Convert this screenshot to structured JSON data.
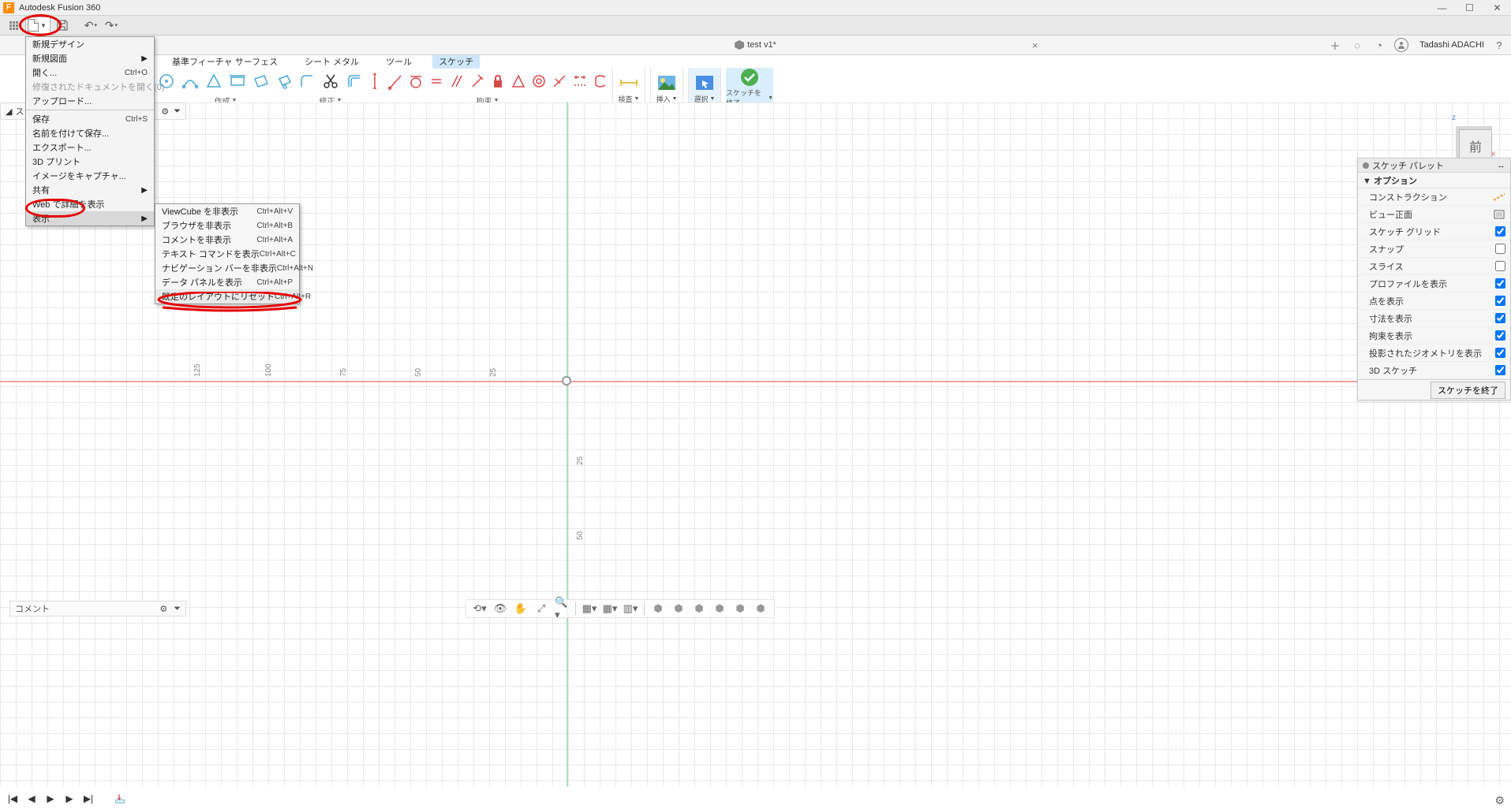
{
  "titlebar": {
    "app": "F",
    "title": "Autodesk Fusion 360"
  },
  "doc": {
    "name": "test v1*",
    "username": "Tadashi ADACHI"
  },
  "tabs": [
    "基準フィーチャ サーフェス",
    "シート メタル",
    "ツール",
    "スケッチ"
  ],
  "active_tab": "スケッチ",
  "ribbon": {
    "create": "作成",
    "modify": "修正",
    "constrain": "拘束",
    "inspect": "検査",
    "insert": "挿入",
    "select": "選択",
    "finish": "スケッチを終了"
  },
  "browser_strip": {
    "label": "ス"
  },
  "file_menu": [
    {
      "label": "新規デザイン"
    },
    {
      "label": "新規図面",
      "arrow": true
    },
    {
      "label": "開く...",
      "shortcut": "Ctrl+O"
    },
    {
      "label": "修復されたドキュメントを開く(0)",
      "disabled": true
    },
    {
      "label": "アップロード..."
    },
    {
      "sep": true
    },
    {
      "label": "保存",
      "shortcut": "Ctrl+S"
    },
    {
      "label": "名前を付けて保存..."
    },
    {
      "label": "エクスポート..."
    },
    {
      "label": "3D プリント"
    },
    {
      "label": "イメージをキャプチャ..."
    },
    {
      "label": "共有",
      "arrow": true
    },
    {
      "label": "Web で詳細を表示"
    },
    {
      "label": "表示",
      "arrow": true,
      "active": true
    }
  ],
  "view_menu": [
    {
      "label": "ViewCube を非表示",
      "shortcut": "Ctrl+Alt+V"
    },
    {
      "label": "ブラウザを非表示",
      "shortcut": "Ctrl+Alt+B"
    },
    {
      "label": "コメントを非表示",
      "shortcut": "Ctrl+Alt+A"
    },
    {
      "label": "テキスト コマンドを表示",
      "shortcut": "Ctrl+Alt+C"
    },
    {
      "label": "ナビゲーション バーを非表示",
      "shortcut": "Ctrl+Alt+N"
    },
    {
      "label": "データ パネルを表示",
      "shortcut": "Ctrl+Alt+P"
    },
    {
      "label": "既定のレイアウトにリセット",
      "shortcut": "Ctrl+Alt+R",
      "hl": true
    }
  ],
  "palette": {
    "title": "スケッチ パレット",
    "section": "▼ オプション",
    "rows": [
      {
        "label": "コンストラクション",
        "type": "icon"
      },
      {
        "label": "ビュー正面",
        "type": "icon2"
      },
      {
        "label": "スケッチ グリッド",
        "type": "check",
        "checked": true
      },
      {
        "label": "スナップ",
        "type": "check",
        "checked": false
      },
      {
        "label": "スライス",
        "type": "check",
        "checked": false
      },
      {
        "label": "プロファイルを表示",
        "type": "check",
        "checked": true
      },
      {
        "label": "点を表示",
        "type": "check",
        "checked": true
      },
      {
        "label": "寸法を表示",
        "type": "check",
        "checked": true
      },
      {
        "label": "拘束を表示",
        "type": "check",
        "checked": true
      },
      {
        "label": "投影されたジオメトリを表示",
        "type": "check",
        "checked": true
      },
      {
        "label": "3D スケッチ",
        "type": "check",
        "checked": true
      }
    ],
    "finish_btn": "スケッチを終了"
  },
  "ruler": {
    "h": [
      "125",
      "100",
      "75",
      "50",
      "25"
    ],
    "v": [
      "25",
      "50"
    ]
  },
  "viewcube": {
    "z": "z",
    "x": "x",
    "face": "前"
  },
  "comment": "コメント"
}
